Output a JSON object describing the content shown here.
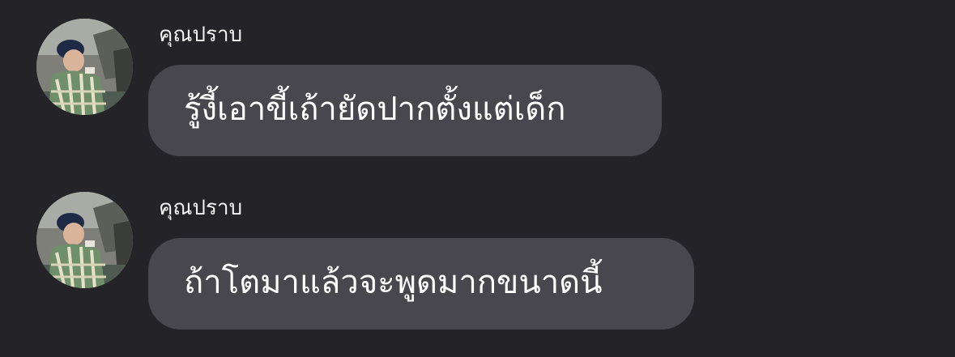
{
  "colors": {
    "background": "#232328",
    "bubble": "#47474d",
    "text": "#ffffff"
  },
  "messages": [
    {
      "sender": "คุณปราบ",
      "avatar_icon": "user-avatar-photo",
      "text": "รู้งี้เอาขี้เถ้ายัดปากตั้งแต่เด็ก"
    },
    {
      "sender": "คุณปราบ",
      "avatar_icon": "user-avatar-photo",
      "text": "ถ้าโตมาแล้วจะพูดมากขนาดนี้"
    }
  ]
}
